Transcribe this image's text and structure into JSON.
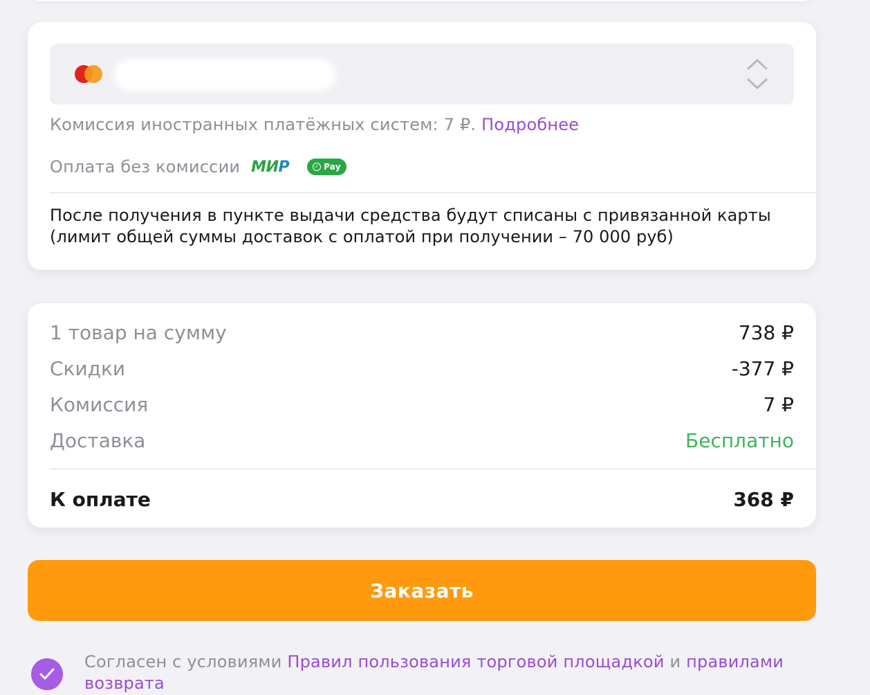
{
  "payment": {
    "card_brand_icon": "mastercard-icon",
    "commission_text": "Комиссия иностранных платёжных систем: 7 ₽.",
    "commission_link": "Подробнее",
    "no_commission_text": "Оплата без комиссии",
    "mir_logo_text": "МИ",
    "mir_logo_text_p": "Р",
    "sbp_pay_label": "Pay",
    "info_text": "После получения в пункте выдачи средства будут списаны с привязанной карты (лимит общей суммы доставок с оплатой при получении – 70 000 руб)"
  },
  "summary": {
    "rows": [
      {
        "label": "1 товар на сумму",
        "value": "738 ₽"
      },
      {
        "label": "Скидки",
        "value": "-377 ₽"
      },
      {
        "label": "Комиссия",
        "value": "7 ₽"
      },
      {
        "label": "Доставка",
        "value": "Бесплатно"
      }
    ],
    "total_label": "К оплате",
    "total_value": "368 ₽"
  },
  "order_button": {
    "label": "Заказать"
  },
  "agreement": {
    "checked": true,
    "prefix": "Согласен с условиями",
    "link1": "Правил пользования торговой площадкой",
    "conjunction": "и",
    "link2": "правилами возврата"
  },
  "colors": {
    "accent_orange": "#ff9a0e",
    "link_purple": "#9b4cd0",
    "checkbox_purple": "#a65ce3",
    "free_green": "#3cb55a",
    "muted_text": "#8f8f99"
  }
}
